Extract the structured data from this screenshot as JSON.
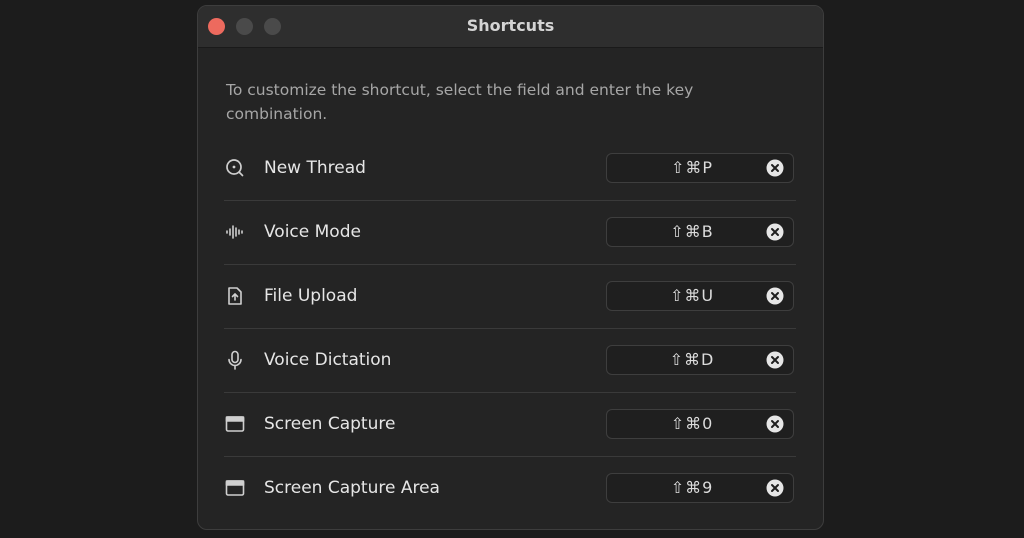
{
  "window": {
    "title": "Shortcuts",
    "description": "To customize the shortcut, select the field and enter the key combination."
  },
  "shortcuts": [
    {
      "label": "New Thread",
      "keys": "⇧⌘P",
      "icon": "new-thread-icon"
    },
    {
      "label": "Voice Mode",
      "keys": "⇧⌘B",
      "icon": "waveform-icon"
    },
    {
      "label": "File Upload",
      "keys": "⇧⌘U",
      "icon": "file-upload-icon"
    },
    {
      "label": "Voice Dictation",
      "keys": "⇧⌘D",
      "icon": "microphone-icon"
    },
    {
      "label": "Screen Capture",
      "keys": "⇧⌘0",
      "icon": "window-icon"
    },
    {
      "label": "Screen Capture Area",
      "keys": "⇧⌘9",
      "icon": "window-icon"
    }
  ],
  "colors": {
    "close_button": "#ed6a5e",
    "background": "#242424"
  }
}
